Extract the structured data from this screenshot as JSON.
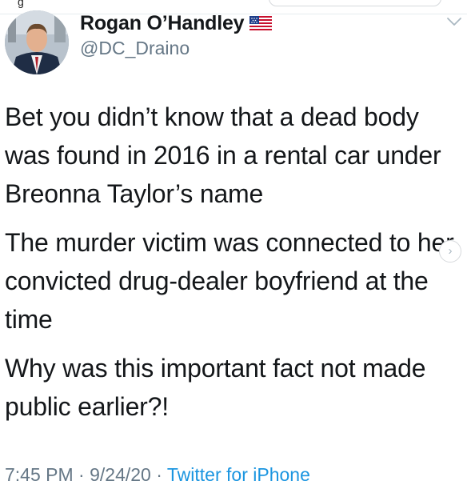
{
  "top": {
    "glyph": "g"
  },
  "author": {
    "name": "Rogan O’Handley",
    "handle": "@DC_Draino",
    "flag_icon": "us-flag-emoji"
  },
  "tweet": {
    "paragraphs": [
      "Bet you didn’t know that a dead body was found in 2016 in a rental car under Breonna Taylor’s name",
      "The murder victim was connected to her convicted drug-dealer boyfriend at the time",
      "Why was this important fact not made public earlier?!"
    ]
  },
  "meta": {
    "time": "7:45 PM",
    "separator": " · ",
    "date": "9/24/20",
    "source": "Twitter for iPhone"
  },
  "colors": {
    "text": "#14171a",
    "secondary": "#657786",
    "link": "#1b95e0"
  },
  "icons": {
    "menu": "chevron-down-icon",
    "next": "chevron-right-icon"
  }
}
